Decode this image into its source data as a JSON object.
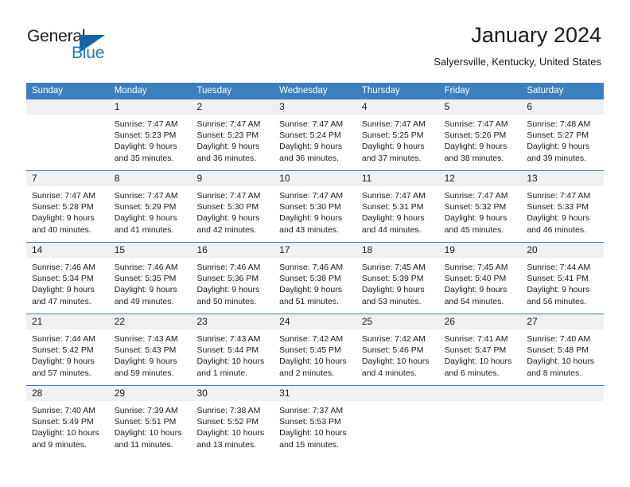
{
  "logo": {
    "word1": "General",
    "word2": "Blue",
    "triangle_color": "#1463a5",
    "blue_text_color": "#1f7ac0"
  },
  "header": {
    "title": "January 2024",
    "subtitle": "Salyersville, Kentucky, United States"
  },
  "theme": {
    "header_bg": "#3d7ebe",
    "daynum_bg": "#f0f0f0",
    "text": "#1b1b1b"
  },
  "weekdays": [
    "Sunday",
    "Monday",
    "Tuesday",
    "Wednesday",
    "Thursday",
    "Friday",
    "Saturday"
  ],
  "weeks": [
    [
      {
        "day": "",
        "sunrise": "",
        "sunset": "",
        "daylight1": "",
        "daylight2": ""
      },
      {
        "day": "1",
        "sunrise": "Sunrise: 7:47 AM",
        "sunset": "Sunset: 5:23 PM",
        "daylight1": "Daylight: 9 hours",
        "daylight2": "and 35 minutes."
      },
      {
        "day": "2",
        "sunrise": "Sunrise: 7:47 AM",
        "sunset": "Sunset: 5:23 PM",
        "daylight1": "Daylight: 9 hours",
        "daylight2": "and 36 minutes."
      },
      {
        "day": "3",
        "sunrise": "Sunrise: 7:47 AM",
        "sunset": "Sunset: 5:24 PM",
        "daylight1": "Daylight: 9 hours",
        "daylight2": "and 36 minutes."
      },
      {
        "day": "4",
        "sunrise": "Sunrise: 7:47 AM",
        "sunset": "Sunset: 5:25 PM",
        "daylight1": "Daylight: 9 hours",
        "daylight2": "and 37 minutes."
      },
      {
        "day": "5",
        "sunrise": "Sunrise: 7:47 AM",
        "sunset": "Sunset: 5:26 PM",
        "daylight1": "Daylight: 9 hours",
        "daylight2": "and 38 minutes."
      },
      {
        "day": "6",
        "sunrise": "Sunrise: 7:48 AM",
        "sunset": "Sunset: 5:27 PM",
        "daylight1": "Daylight: 9 hours",
        "daylight2": "and 39 minutes."
      }
    ],
    [
      {
        "day": "7",
        "sunrise": "Sunrise: 7:47 AM",
        "sunset": "Sunset: 5:28 PM",
        "daylight1": "Daylight: 9 hours",
        "daylight2": "and 40 minutes."
      },
      {
        "day": "8",
        "sunrise": "Sunrise: 7:47 AM",
        "sunset": "Sunset: 5:29 PM",
        "daylight1": "Daylight: 9 hours",
        "daylight2": "and 41 minutes."
      },
      {
        "day": "9",
        "sunrise": "Sunrise: 7:47 AM",
        "sunset": "Sunset: 5:30 PM",
        "daylight1": "Daylight: 9 hours",
        "daylight2": "and 42 minutes."
      },
      {
        "day": "10",
        "sunrise": "Sunrise: 7:47 AM",
        "sunset": "Sunset: 5:30 PM",
        "daylight1": "Daylight: 9 hours",
        "daylight2": "and 43 minutes."
      },
      {
        "day": "11",
        "sunrise": "Sunrise: 7:47 AM",
        "sunset": "Sunset: 5:31 PM",
        "daylight1": "Daylight: 9 hours",
        "daylight2": "and 44 minutes."
      },
      {
        "day": "12",
        "sunrise": "Sunrise: 7:47 AM",
        "sunset": "Sunset: 5:32 PM",
        "daylight1": "Daylight: 9 hours",
        "daylight2": "and 45 minutes."
      },
      {
        "day": "13",
        "sunrise": "Sunrise: 7:47 AM",
        "sunset": "Sunset: 5:33 PM",
        "daylight1": "Daylight: 9 hours",
        "daylight2": "and 46 minutes."
      }
    ],
    [
      {
        "day": "14",
        "sunrise": "Sunrise: 7:46 AM",
        "sunset": "Sunset: 5:34 PM",
        "daylight1": "Daylight: 9 hours",
        "daylight2": "and 47 minutes."
      },
      {
        "day": "15",
        "sunrise": "Sunrise: 7:46 AM",
        "sunset": "Sunset: 5:35 PM",
        "daylight1": "Daylight: 9 hours",
        "daylight2": "and 49 minutes."
      },
      {
        "day": "16",
        "sunrise": "Sunrise: 7:46 AM",
        "sunset": "Sunset: 5:36 PM",
        "daylight1": "Daylight: 9 hours",
        "daylight2": "and 50 minutes."
      },
      {
        "day": "17",
        "sunrise": "Sunrise: 7:46 AM",
        "sunset": "Sunset: 5:38 PM",
        "daylight1": "Daylight: 9 hours",
        "daylight2": "and 51 minutes."
      },
      {
        "day": "18",
        "sunrise": "Sunrise: 7:45 AM",
        "sunset": "Sunset: 5:39 PM",
        "daylight1": "Daylight: 9 hours",
        "daylight2": "and 53 minutes."
      },
      {
        "day": "19",
        "sunrise": "Sunrise: 7:45 AM",
        "sunset": "Sunset: 5:40 PM",
        "daylight1": "Daylight: 9 hours",
        "daylight2": "and 54 minutes."
      },
      {
        "day": "20",
        "sunrise": "Sunrise: 7:44 AM",
        "sunset": "Sunset: 5:41 PM",
        "daylight1": "Daylight: 9 hours",
        "daylight2": "and 56 minutes."
      }
    ],
    [
      {
        "day": "21",
        "sunrise": "Sunrise: 7:44 AM",
        "sunset": "Sunset: 5:42 PM",
        "daylight1": "Daylight: 9 hours",
        "daylight2": "and 57 minutes."
      },
      {
        "day": "22",
        "sunrise": "Sunrise: 7:43 AM",
        "sunset": "Sunset: 5:43 PM",
        "daylight1": "Daylight: 9 hours",
        "daylight2": "and 59 minutes."
      },
      {
        "day": "23",
        "sunrise": "Sunrise: 7:43 AM",
        "sunset": "Sunset: 5:44 PM",
        "daylight1": "Daylight: 10 hours",
        "daylight2": "and 1 minute."
      },
      {
        "day": "24",
        "sunrise": "Sunrise: 7:42 AM",
        "sunset": "Sunset: 5:45 PM",
        "daylight1": "Daylight: 10 hours",
        "daylight2": "and 2 minutes."
      },
      {
        "day": "25",
        "sunrise": "Sunrise: 7:42 AM",
        "sunset": "Sunset: 5:46 PM",
        "daylight1": "Daylight: 10 hours",
        "daylight2": "and 4 minutes."
      },
      {
        "day": "26",
        "sunrise": "Sunrise: 7:41 AM",
        "sunset": "Sunset: 5:47 PM",
        "daylight1": "Daylight: 10 hours",
        "daylight2": "and 6 minutes."
      },
      {
        "day": "27",
        "sunrise": "Sunrise: 7:40 AM",
        "sunset": "Sunset: 5:48 PM",
        "daylight1": "Daylight: 10 hours",
        "daylight2": "and 8 minutes."
      }
    ],
    [
      {
        "day": "28",
        "sunrise": "Sunrise: 7:40 AM",
        "sunset": "Sunset: 5:49 PM",
        "daylight1": "Daylight: 10 hours",
        "daylight2": "and 9 minutes."
      },
      {
        "day": "29",
        "sunrise": "Sunrise: 7:39 AM",
        "sunset": "Sunset: 5:51 PM",
        "daylight1": "Daylight: 10 hours",
        "daylight2": "and 11 minutes."
      },
      {
        "day": "30",
        "sunrise": "Sunrise: 7:38 AM",
        "sunset": "Sunset: 5:52 PM",
        "daylight1": "Daylight: 10 hours",
        "daylight2": "and 13 minutes."
      },
      {
        "day": "31",
        "sunrise": "Sunrise: 7:37 AM",
        "sunset": "Sunset: 5:53 PM",
        "daylight1": "Daylight: 10 hours",
        "daylight2": "and 15 minutes."
      },
      {
        "day": "",
        "sunrise": "",
        "sunset": "",
        "daylight1": "",
        "daylight2": ""
      },
      {
        "day": "",
        "sunrise": "",
        "sunset": "",
        "daylight1": "",
        "daylight2": ""
      },
      {
        "day": "",
        "sunrise": "",
        "sunset": "",
        "daylight1": "",
        "daylight2": ""
      }
    ]
  ]
}
